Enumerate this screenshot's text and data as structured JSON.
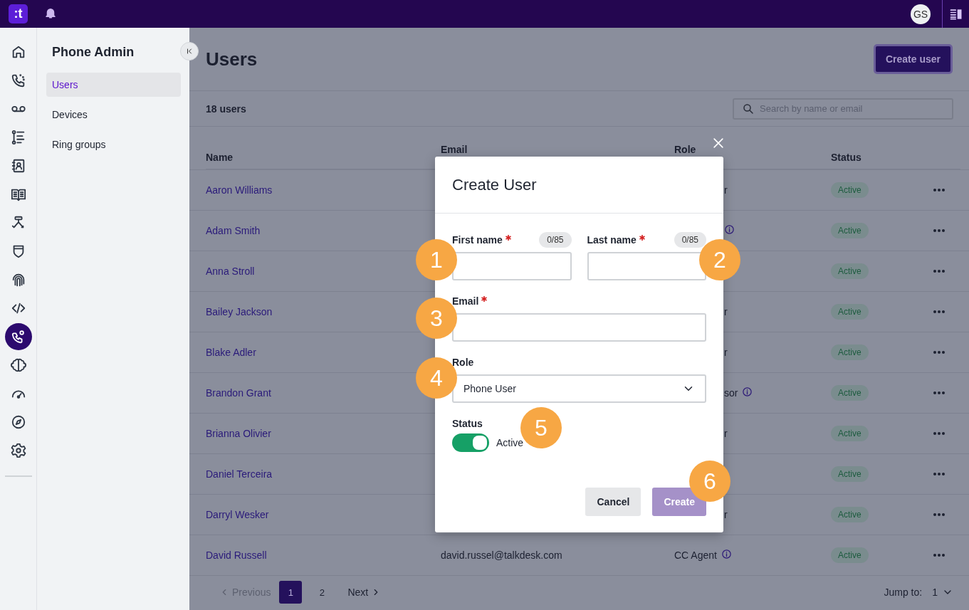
{
  "top_bar": {
    "logo": ":t",
    "avatar": "GS"
  },
  "rail": {
    "items": [
      {
        "selected": false
      },
      {
        "selected": false
      },
      {
        "selected": false
      },
      {
        "selected": false
      },
      {
        "selected": false
      },
      {
        "selected": false
      },
      {
        "selected": false
      },
      {
        "selected": false
      },
      {
        "selected": false
      },
      {
        "selected": false
      },
      {
        "selected": true
      },
      {
        "selected": false
      },
      {
        "selected": false
      },
      {
        "selected": false
      },
      {
        "selected": false
      }
    ]
  },
  "nav": {
    "title": "Phone Admin",
    "items": [
      {
        "label": "Users",
        "selected": true
      },
      {
        "label": "Devices",
        "selected": false
      },
      {
        "label": "Ring groups",
        "selected": false
      }
    ]
  },
  "page": {
    "title": "Users",
    "create_button": "Create user",
    "count": "18 users",
    "search": {
      "placeholder": "Search by name or email"
    }
  },
  "table": {
    "columns": [
      "Name",
      "Email",
      "Role",
      "Status"
    ],
    "rows": [
      {
        "name": "Aaron Williams",
        "role": "r",
        "info": false,
        "status": "Active"
      },
      {
        "name": "Adam Smith",
        "info": true,
        "status": "Active"
      },
      {
        "name": "Anna Stroll",
        "info": false,
        "status": "Active"
      },
      {
        "name": "Bailey Jackson",
        "role": "r",
        "info": false,
        "status": "Active"
      },
      {
        "name": "Blake Adler",
        "role": "r",
        "info": false,
        "status": "Active"
      },
      {
        "name": "Brandon Grant",
        "role": "sor",
        "info": true,
        "status": "Active"
      },
      {
        "name": "Brianna Olivier",
        "role": "r",
        "info": false,
        "status": "Active"
      },
      {
        "name": "Daniel Terceira",
        "info": false,
        "status": "Active"
      },
      {
        "name": "Darryl Wesker",
        "role": "r",
        "info": false,
        "status": "Active"
      },
      {
        "name": "David Russell",
        "email": "david.russel@talkdesk.com",
        "role": "CC Agent",
        "info": true,
        "status": "Active"
      }
    ]
  },
  "pagination": {
    "previous": "Previous",
    "previous_disabled": true,
    "pages": [
      {
        "label": "1",
        "selected": true
      },
      {
        "label": "2",
        "selected": false
      }
    ],
    "next": "Next",
    "jump_label": "Jump to:",
    "jump_value": "1"
  },
  "dialog": {
    "title": "Create User",
    "first_name": {
      "label": "First name",
      "required": true,
      "counter": "0/85"
    },
    "last_name": {
      "label": "Last name",
      "required": true,
      "counter": "0/85"
    },
    "email": {
      "label": "Email",
      "required": true
    },
    "role": {
      "label": "Role",
      "value": "Phone User"
    },
    "status": {
      "label": "Status",
      "on": true,
      "text": "Active"
    },
    "cancel": "Cancel",
    "create": {
      "label": "Create",
      "disabled": true
    }
  },
  "annotations": [
    "1",
    "2",
    "3",
    "4",
    "5",
    "6"
  ]
}
